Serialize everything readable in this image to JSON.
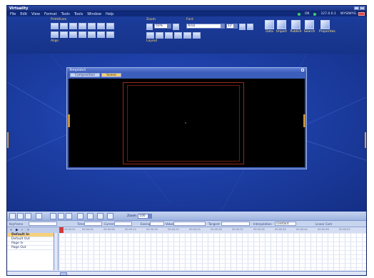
{
  "app": {
    "title": "Virtuality"
  },
  "menu": [
    "File",
    "Edit",
    "View",
    "Format",
    "Tools",
    "Tools",
    "Window",
    "Help"
  ],
  "status": {
    "server": "OK",
    "ip": "127.0.0.1",
    "mode": "WYSIWYG"
  },
  "toolbar": {
    "primitives_label": "Primitives",
    "align_label": "Align",
    "zoom_label": "Zoom",
    "font_label": "Font",
    "layout_label": "Layout",
    "zoom_value": "50%",
    "font_value": "Arial",
    "size_value": "12",
    "big_buttons": [
      "Data",
      "Import",
      "Publish",
      "Search",
      "Properties"
    ]
  },
  "template_window": {
    "title": "Template1",
    "tabs": [
      "Composition",
      "Scene"
    ]
  },
  "bottom": {
    "zoom_label": "Zoom",
    "zoom_value": "100",
    "props": [
      "Keyframe",
      "Time",
      "Current",
      "Easing",
      "Value",
      "Tangent",
      "Interpolation",
      "Linear Cont"
    ],
    "interpolation_value": "constant",
    "tracks": [
      "Default In",
      "Default Out",
      "Page In",
      "Page Out"
    ],
    "ruler_ticks": [
      "00:00:01",
      "00:00:04",
      "00:00:08",
      "00:00:12",
      "00:00:16",
      "00:00:20",
      "00:00:24",
      "00:00:28",
      "00:00:32",
      "00:00:36",
      "00:00:40",
      "00:00:44",
      "00:00:48",
      "00:00:52"
    ]
  },
  "colors": {
    "bg": "#16358f",
    "accent": "#f3cf7c",
    "canvas": "#000000",
    "safe_area": "#9a2a1a"
  }
}
